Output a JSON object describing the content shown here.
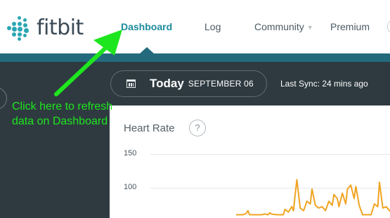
{
  "nav": {
    "brand": "fitbit",
    "items": [
      {
        "label": "Dashboard",
        "active": true
      },
      {
        "label": "Log",
        "active": false
      },
      {
        "label": "Community",
        "active": false
      },
      {
        "label": "Premium",
        "active": false
      }
    ],
    "accent_color": "#236a7d"
  },
  "subheader": {
    "today_label": "Today",
    "date_label": "SEPTEMBER 06",
    "sync_text": "Last Sync: 24 mins ago"
  },
  "card": {
    "title": "Heart Rate",
    "help_icon_label": "?",
    "icons": {
      "help": "question-circle-icon",
      "date": "calendar-icon"
    }
  },
  "chart_data": {
    "type": "line",
    "title": "Heart Rate",
    "xlabel": "",
    "ylabel": "",
    "y_ticks": [
      150,
      100
    ],
    "ylim": [
      60,
      150
    ],
    "line_color": "#f0a422",
    "series": [
      {
        "values": [
          [
            0,
            60
          ],
          [
            2,
            60
          ],
          [
            4,
            60
          ],
          [
            6,
            62
          ],
          [
            7,
            66
          ],
          [
            8,
            60
          ],
          [
            10,
            60
          ],
          [
            15,
            60
          ],
          [
            17,
            61
          ],
          [
            19,
            60
          ],
          [
            20,
            63
          ],
          [
            21,
            61
          ],
          [
            24,
            60
          ],
          [
            28,
            60
          ],
          [
            29,
            68
          ],
          [
            31,
            64
          ],
          [
            33,
            72
          ],
          [
            34,
            66
          ],
          [
            36,
            112
          ],
          [
            38,
            70
          ],
          [
            40,
            66
          ],
          [
            42,
            80
          ],
          [
            44,
            76
          ],
          [
            45,
            98
          ],
          [
            47,
            74
          ],
          [
            49,
            70
          ],
          [
            51,
            72
          ],
          [
            53,
            66
          ],
          [
            55,
            80
          ],
          [
            57,
            74
          ],
          [
            58,
            90
          ],
          [
            60,
            84
          ],
          [
            61,
            72
          ],
          [
            63,
            92
          ],
          [
            65,
            76
          ],
          [
            66,
            98
          ],
          [
            68,
            104
          ],
          [
            70,
            84
          ],
          [
            71,
            102
          ],
          [
            73,
            74
          ],
          [
            75,
            60
          ],
          [
            80,
            60
          ],
          [
            82,
            76
          ],
          [
            84,
            72
          ],
          [
            85,
            108
          ],
          [
            87,
            70
          ],
          [
            89,
            72
          ],
          [
            91,
            66
          ],
          [
            93,
            60
          ],
          [
            97,
            60
          ],
          [
            99,
            68
          ],
          [
            100,
            60
          ]
        ]
      }
    ]
  },
  "annotation": {
    "text": "Click here to refresh\ndata on Dashboard",
    "color": "#1ee61e"
  }
}
